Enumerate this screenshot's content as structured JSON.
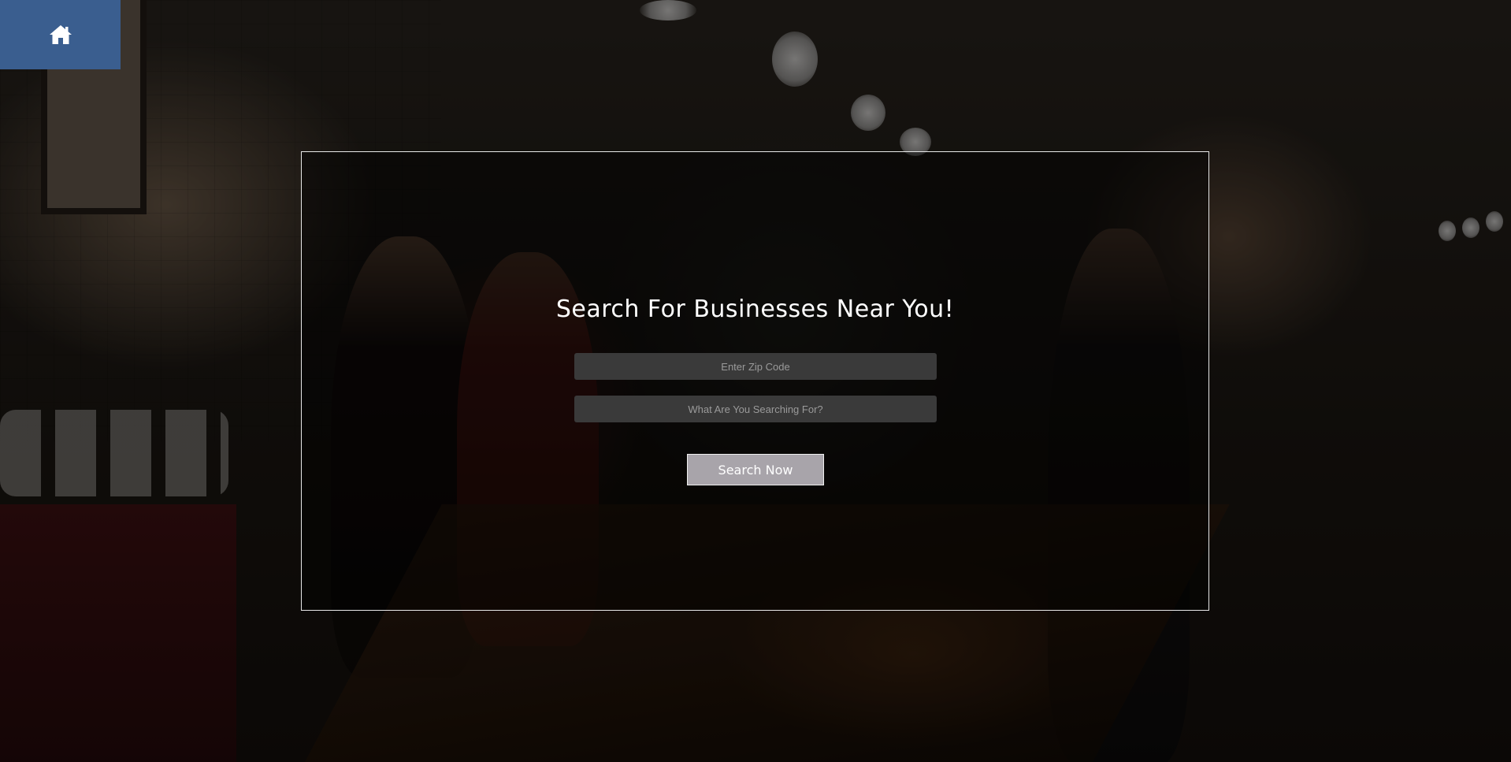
{
  "nav": {
    "home_icon": "home-icon"
  },
  "search": {
    "title": "Search For Businesses Near You!",
    "zip_placeholder": "Enter Zip Code",
    "zip_value": "",
    "query_placeholder": "What Are You Searching For?",
    "query_value": "",
    "button_label": "Search Now"
  },
  "colors": {
    "home_button_bg": "#3a5e8f",
    "search_button_bg": "#a8a4aa",
    "field_bg": "#3a3a3a",
    "panel_border": "#e8e8e8"
  }
}
